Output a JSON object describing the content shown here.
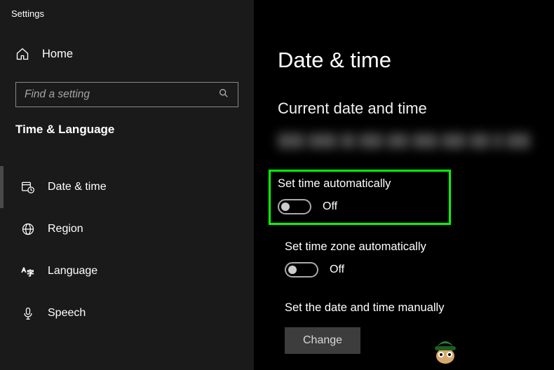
{
  "app": {
    "title": "Settings"
  },
  "sidebar": {
    "home_label": "Home",
    "search_placeholder": "Find a setting",
    "section_title": "Time & Language",
    "items": [
      {
        "label": "Date & time",
        "selected": true
      },
      {
        "label": "Region",
        "selected": false
      },
      {
        "label": "Language",
        "selected": false
      },
      {
        "label": "Speech",
        "selected": false
      }
    ]
  },
  "main": {
    "title": "Date & time",
    "current_heading": "Current date and time",
    "settings": [
      {
        "label": "Set time automatically",
        "state": "Off",
        "highlighted": true
      },
      {
        "label": "Set time zone automatically",
        "state": "Off",
        "highlighted": false
      }
    ],
    "manual_label": "Set the date and time manually",
    "change_button": "Change"
  }
}
